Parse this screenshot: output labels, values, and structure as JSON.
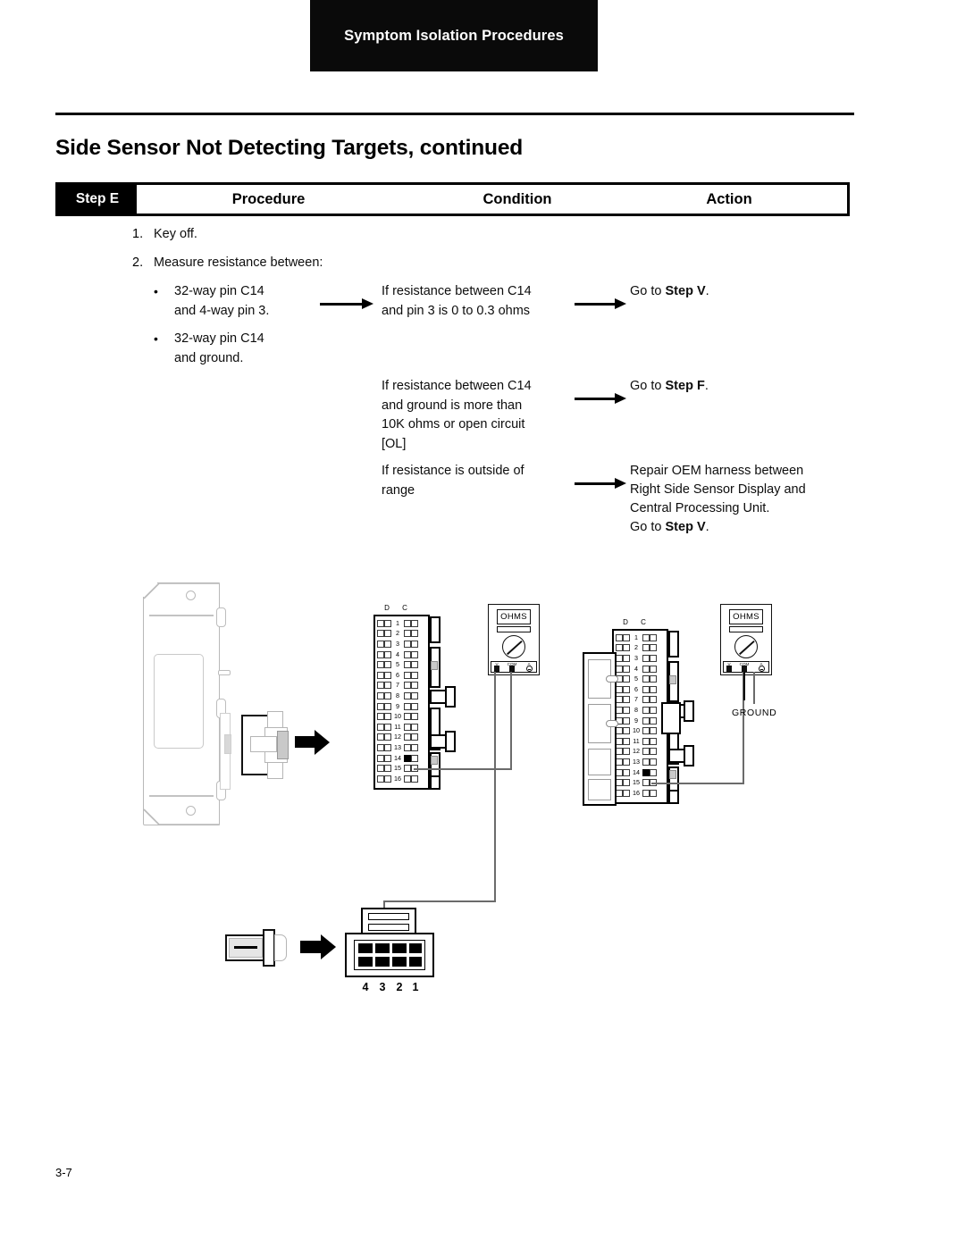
{
  "header": {
    "banner_title": "Symptom Isolation Procedures"
  },
  "page": {
    "title": "Side Sensor Not Detecting Targets, continued",
    "folio": "3-7"
  },
  "table": {
    "headers": {
      "step": "Step E",
      "procedure": "Procedure",
      "condition": "Condition",
      "action": "Action"
    },
    "procedure": {
      "item1_num": "1.",
      "item1_text": "Key off.",
      "item2_num": "2.",
      "item2_text": "Measure resistance between:",
      "bullet_glyph": "•",
      "bullet1": "32-way pin C14\nand 4-way pin 3.",
      "bullet2": "32-way pin C14\nand ground."
    },
    "rows": [
      {
        "condition": "If resistance between C14\nand pin 3 is 0 to 0.3 ohms",
        "action_prefix": "Go to ",
        "action_bold": "Step V",
        "action_suffix": "."
      },
      {
        "condition": "If resistance between C14\nand ground is more than\n10K ohms or open circuit\n[OL]",
        "action_prefix": "Go to ",
        "action_bold": "Step F",
        "action_suffix": "."
      },
      {
        "condition": "If resistance is outside of\nrange",
        "action_line1": "Repair OEM harness between",
        "action_line2": "Right Side Sensor Display and",
        "action_line3": "Central Processing Unit.",
        "action_prefix": "Go to ",
        "action_bold": "Step V",
        "action_suffix": "."
      }
    ]
  },
  "diagram": {
    "connector_a": {
      "col_label_d": "D",
      "col_label_c": "C",
      "pin_numbers": [
        "1",
        "2",
        "3",
        "4",
        "5",
        "6",
        "7",
        "8",
        "9",
        "10",
        "11",
        "12",
        "13",
        "14",
        "15",
        "16"
      ],
      "highlighted_pin": "14"
    },
    "connector_b": {
      "col_label_d": "D",
      "col_label_c": "C",
      "pin_numbers": [
        "1",
        "2",
        "3",
        "4",
        "5",
        "6",
        "7",
        "8",
        "9",
        "10",
        "11",
        "12",
        "13",
        "14",
        "15",
        "16"
      ],
      "highlighted_pin": "14"
    },
    "meter_left": {
      "display": "OHMS",
      "jack_v": "V",
      "jack_com": "COM",
      "jack_a": "A"
    },
    "meter_right": {
      "display": "OHMS",
      "jack_v": "V",
      "jack_com": "COM",
      "jack_a": "A",
      "ground_label": "GROUND"
    },
    "connector_4way": {
      "pin_numbers": [
        "4",
        "3",
        "2",
        "1"
      ]
    }
  },
  "colors": {
    "banner_bg": "#0a0a0a",
    "ink": "#000000",
    "wire": "#6b6b6b",
    "outline_light": "#b9b9b9"
  }
}
